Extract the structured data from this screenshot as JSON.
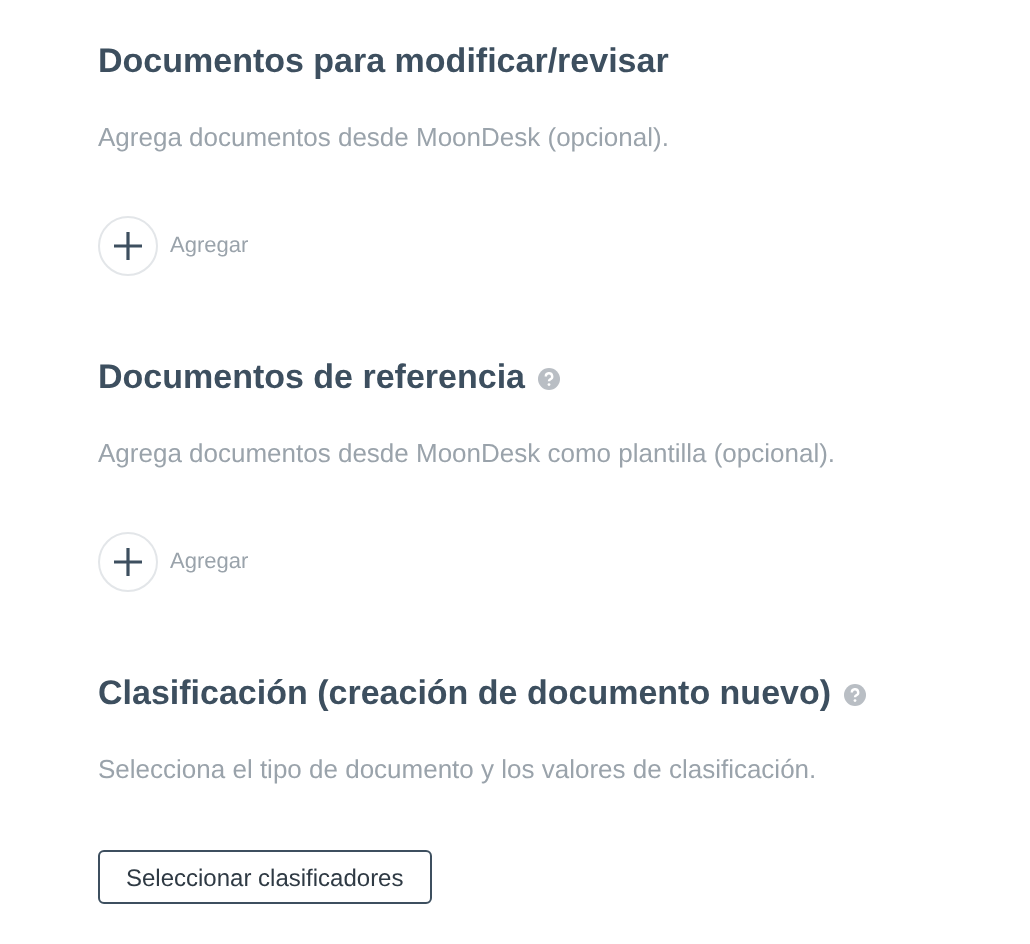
{
  "sections": [
    {
      "title": "Documentos para modificar/revisar",
      "help": false,
      "description": "Agrega documentos desde MoonDesk (opcional).",
      "action": {
        "kind": "add",
        "label": "Agregar"
      }
    },
    {
      "title": "Documentos de referencia",
      "help": true,
      "description": "Agrega documentos desde MoonDesk como plantilla (opcional).",
      "action": {
        "kind": "add",
        "label": "Agregar"
      }
    },
    {
      "title": "Clasificación (creación de documento nuevo)",
      "help": true,
      "description": "Selecciona el tipo de documento y los valores de clasificación.",
      "action": {
        "kind": "button",
        "label": "Seleccionar clasificadores"
      }
    }
  ]
}
